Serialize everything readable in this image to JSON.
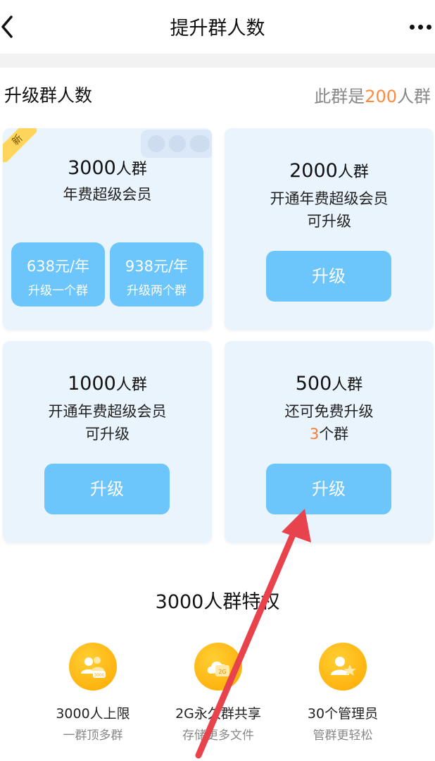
{
  "topbar": {
    "title": "提升群人数",
    "back_icon": "chevron-left-icon",
    "more_icon": "more-dots-icon"
  },
  "section": {
    "title": "升级群人数",
    "status_prefix": "此群是",
    "status_num": "200",
    "status_suffix": "人群"
  },
  "cards": [
    {
      "badge": "新",
      "cap_num": "3000",
      "cap_unit": "人群",
      "line1": "年费超级会员",
      "prices": [
        {
          "price": "638元/年",
          "label": "升级一个群"
        },
        {
          "price": "938元/年",
          "label": "升级两个群"
        }
      ]
    },
    {
      "cap_num": "2000",
      "cap_unit": "人群",
      "line1": "开通年费超级会员",
      "line2": "可升级",
      "button": "升级"
    },
    {
      "cap_num": "1000",
      "cap_unit": "人群",
      "line1": "开通年费超级会员",
      "line2": "可升级",
      "button": "升级"
    },
    {
      "cap_num": "500",
      "cap_unit": "人群",
      "line1": "还可免费升级",
      "line2_num": "3",
      "line2_rest": "个群",
      "button": "升级"
    }
  ],
  "privileges": {
    "title": "3000人群特权",
    "items": [
      {
        "icon": "group-members-icon",
        "icon_text": "3000",
        "name": "3000人上限",
        "sub": "一群顶多群"
      },
      {
        "icon": "cloud-storage-icon",
        "icon_text": "2G",
        "name": "2G永久群共享",
        "sub": "存储更多文件"
      },
      {
        "icon": "admin-star-icon",
        "name": "30个管理员",
        "sub": "管群更轻松"
      }
    ]
  },
  "colors": {
    "accent": "#6cc5fb",
    "orange": "#ff7a2e",
    "card_bg": "#eaf4fd",
    "gold": "#ffa800",
    "arrow": "#e8434c"
  }
}
